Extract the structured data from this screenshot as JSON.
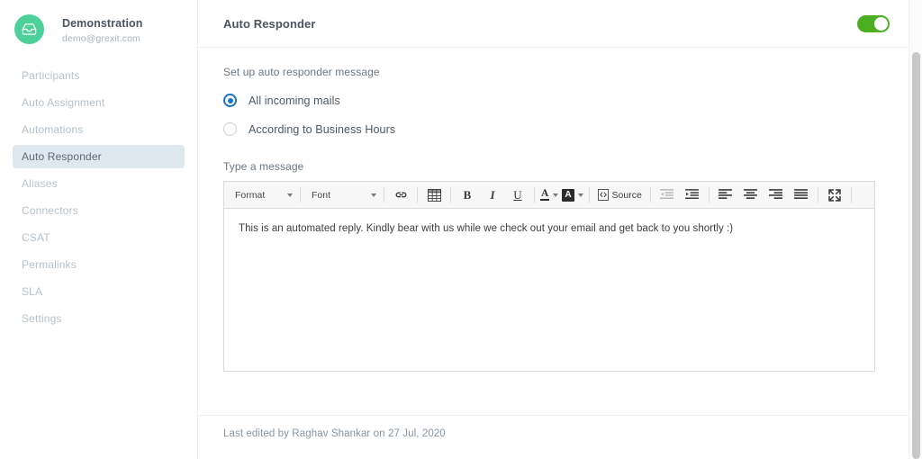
{
  "sidebar": {
    "logo_icon": "inbox-icon",
    "logo_color": "#4ed09a",
    "account_name": "Demonstration",
    "account_email": "demo@grexit.com",
    "active_item": "Auto Responder",
    "items": [
      {
        "label": "Participants",
        "key": "participants",
        "active": false
      },
      {
        "label": "Auto Assignment",
        "key": "auto-assignment",
        "active": false
      },
      {
        "label": "Automations",
        "key": "automations",
        "active": false
      },
      {
        "label": "Auto Responder",
        "key": "auto-responder",
        "active": true
      },
      {
        "label": "Aliases",
        "key": "aliases",
        "active": false
      },
      {
        "label": "Connectors",
        "key": "connectors",
        "active": false
      },
      {
        "label": "CSAT",
        "key": "csat",
        "active": false
      },
      {
        "label": "Permalinks",
        "key": "permalinks",
        "active": false
      },
      {
        "label": "SLA",
        "key": "sla",
        "active": false
      },
      {
        "label": "Settings",
        "key": "settings",
        "active": false
      }
    ]
  },
  "header": {
    "title": "Auto Responder",
    "toggle": {
      "state": "on",
      "color": "#4caf23"
    }
  },
  "main": {
    "section_label": "Set up auto responder message",
    "radio_options": [
      {
        "label": "All incoming mails",
        "selected": true
      },
      {
        "label": "According to Business Hours",
        "selected": false
      }
    ],
    "radio_accent": "#1a73c7",
    "editor_label": "Type a message",
    "message": "This is an automated reply. Kindly bear with us while we check out your email and get back to you shortly :)"
  },
  "toolbar": {
    "format_label": "Format",
    "font_label": "Font",
    "source_label": "Source",
    "bold_label": "B",
    "italic_label": "I",
    "underline_label": "U",
    "text_color_label": "A",
    "bg_color_label": "A",
    "buttons": [
      {
        "name": "link-icon",
        "disabled": false
      },
      {
        "name": "table-icon",
        "disabled": false
      },
      {
        "name": "bold-icon",
        "disabled": false
      },
      {
        "name": "italic-icon",
        "disabled": false
      },
      {
        "name": "underline-icon",
        "disabled": false
      },
      {
        "name": "text-color-icon",
        "disabled": false
      },
      {
        "name": "background-color-icon",
        "disabled": false
      },
      {
        "name": "source-icon",
        "disabled": false
      },
      {
        "name": "outdent-icon",
        "disabled": true
      },
      {
        "name": "indent-icon",
        "disabled": false
      },
      {
        "name": "align-left-icon",
        "disabled": false
      },
      {
        "name": "align-center-icon",
        "disabled": false
      },
      {
        "name": "align-right-icon",
        "disabled": false
      },
      {
        "name": "align-justify-icon",
        "disabled": false
      },
      {
        "name": "maximize-icon",
        "disabled": false
      }
    ]
  },
  "footer": {
    "last_edited": "Last edited by Raghav Shankar on 27 Jul, 2020"
  },
  "scrollbar": {
    "orientation": "vertical"
  }
}
